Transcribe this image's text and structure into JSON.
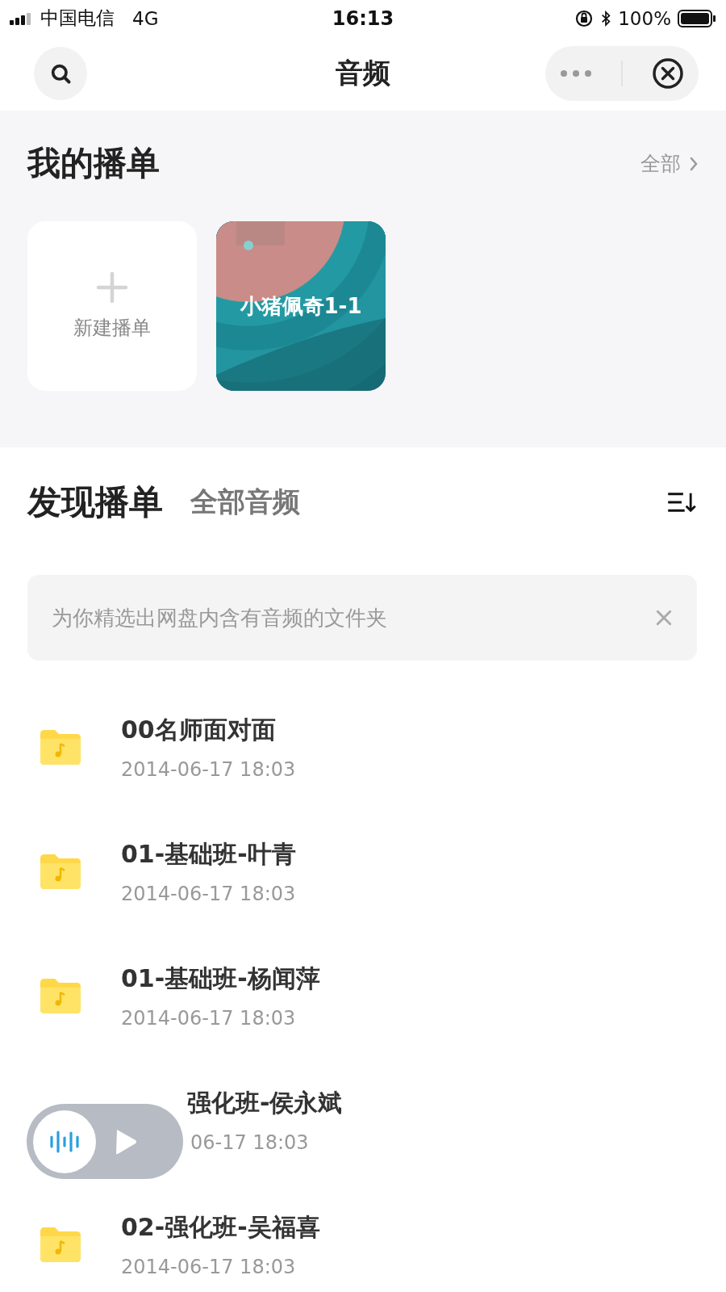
{
  "status_bar": {
    "carrier": "中国电信",
    "network": "4G",
    "time": "16:13",
    "battery": "100%"
  },
  "header": {
    "title": "音频"
  },
  "my_playlists": {
    "title": "我的播单",
    "more": "全部",
    "new_label": "新建播单",
    "playlists": [
      {
        "name": "小猪佩奇1-1",
        "kind": "picture"
      }
    ]
  },
  "discover": {
    "tabs": [
      {
        "label": "发现播单",
        "selected": true
      },
      {
        "label": "全部音频",
        "selected": false
      }
    ],
    "notice": "为你精选出网盘内含有音频的文件夹",
    "folders": [
      {
        "name": "00名师面对面",
        "date": "2014-06-17 18:03"
      },
      {
        "name": "01-基础班-叶青",
        "date": "2014-06-17 18:03"
      },
      {
        "name": "01-基础班-杨闻萍",
        "date": "2014-06-17 18:03"
      },
      {
        "name": "强化班-侯永斌",
        "date": "06-17 18:03",
        "covered": true
      },
      {
        "name": "02-强化班-吴福喜",
        "date": "2014-06-17 18:03"
      }
    ]
  }
}
